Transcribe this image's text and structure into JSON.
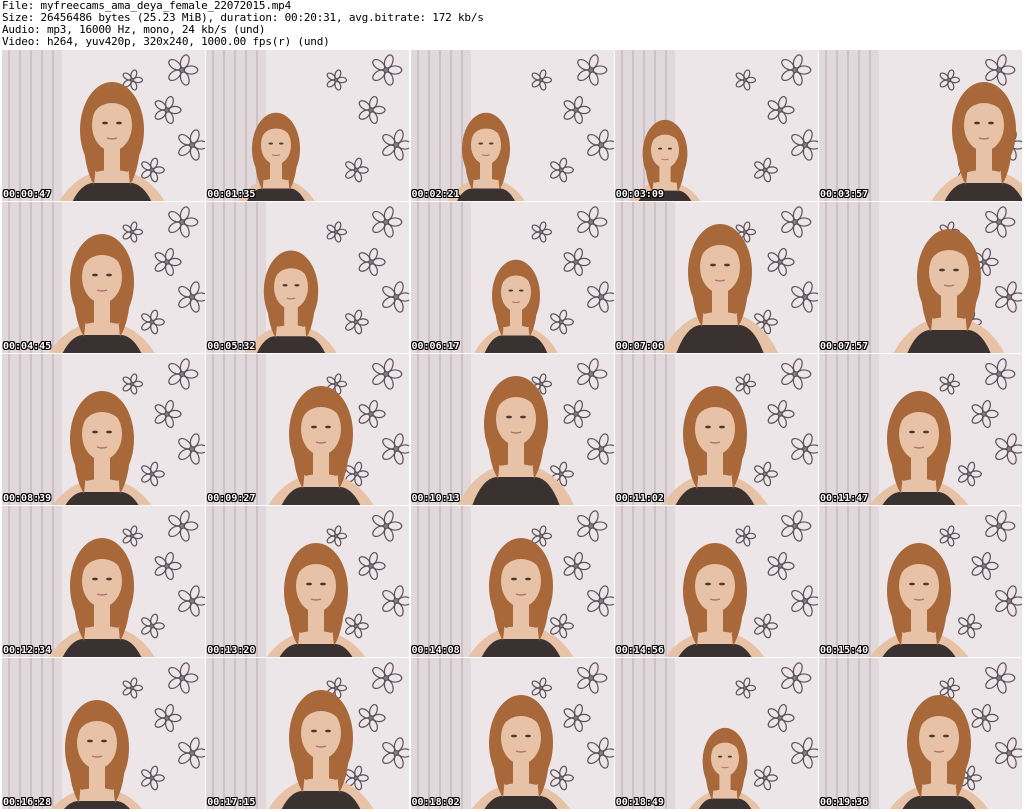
{
  "header": {
    "file_line": "File: myfreecams_ama_deya_female_22072015.mp4",
    "size_line": "Size: 26456486 bytes (25.23 MiB), duration: 00:20:31, avg.bitrate: 172 kb/s",
    "audio_line": "Audio: mp3, 16000 Hz, mono, 24 kb/s (und)",
    "video_line": "Video: h264, yuv420p, 320x240, 1000.00 fps(r) (und)"
  },
  "thumbnails": [
    {
      "timestamp": "00:00:47"
    },
    {
      "timestamp": "00:01:35"
    },
    {
      "timestamp": "00:02:21"
    },
    {
      "timestamp": "00:03:09"
    },
    {
      "timestamp": "00:03:57"
    },
    {
      "timestamp": "00:04:45"
    },
    {
      "timestamp": "00:05:32"
    },
    {
      "timestamp": "00:06:17"
    },
    {
      "timestamp": "00:07:06"
    },
    {
      "timestamp": "00:07:57"
    },
    {
      "timestamp": "00:08:39"
    },
    {
      "timestamp": "00:09:27"
    },
    {
      "timestamp": "00:10:13"
    },
    {
      "timestamp": "00:11:02"
    },
    {
      "timestamp": "00:11:47"
    },
    {
      "timestamp": "00:12:34"
    },
    {
      "timestamp": "00:13:20"
    },
    {
      "timestamp": "00:14:08"
    },
    {
      "timestamp": "00:14:56"
    },
    {
      "timestamp": "00:15:40"
    },
    {
      "timestamp": "00:16:28"
    },
    {
      "timestamp": "00:17:15"
    },
    {
      "timestamp": "00:18:02"
    },
    {
      "timestamp": "00:18:49"
    },
    {
      "timestamp": "00:19:36"
    }
  ],
  "colors": {
    "background": "#ffffff",
    "header_text": "#000000",
    "wallpaper": "#ece6e8",
    "curtain": "#d8cfd0",
    "flower_outline": "#5b5057",
    "hair": "#a8683a",
    "skin": "#e8c2a6",
    "top": "#3a3230",
    "timestamp_text": "#ffffff"
  }
}
